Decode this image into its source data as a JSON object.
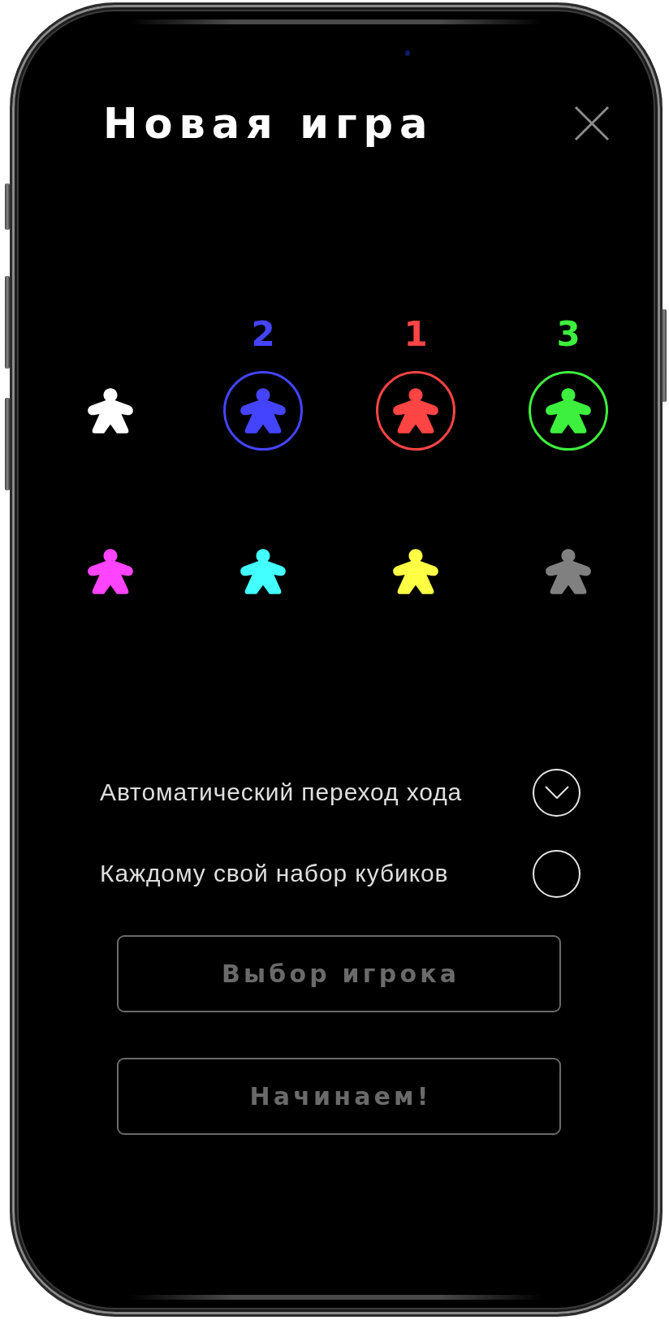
{
  "title": "Новая игра",
  "players": [
    {
      "color": "#ffffff",
      "selected": false
    },
    {
      "color": "#4444ff",
      "selected": true,
      "order": "2"
    },
    {
      "color": "#ff4444",
      "selected": true,
      "order": "1"
    },
    {
      "color": "#3ef03e",
      "selected": true,
      "order": "3"
    },
    {
      "color": "#ff44ff",
      "selected": false
    },
    {
      "color": "#44ffff",
      "selected": false
    },
    {
      "color": "#ffff44",
      "selected": false
    },
    {
      "color": "#808080",
      "selected": false
    }
  ],
  "options": [
    {
      "label": "Автоматический переход хода",
      "checked": true
    },
    {
      "label": "Каждому свой набор кубиков",
      "checked": false
    }
  ],
  "buttons": [
    {
      "label": "Выбор игрока",
      "disabled": true
    },
    {
      "label": "Начинаем!",
      "disabled": true
    }
  ]
}
